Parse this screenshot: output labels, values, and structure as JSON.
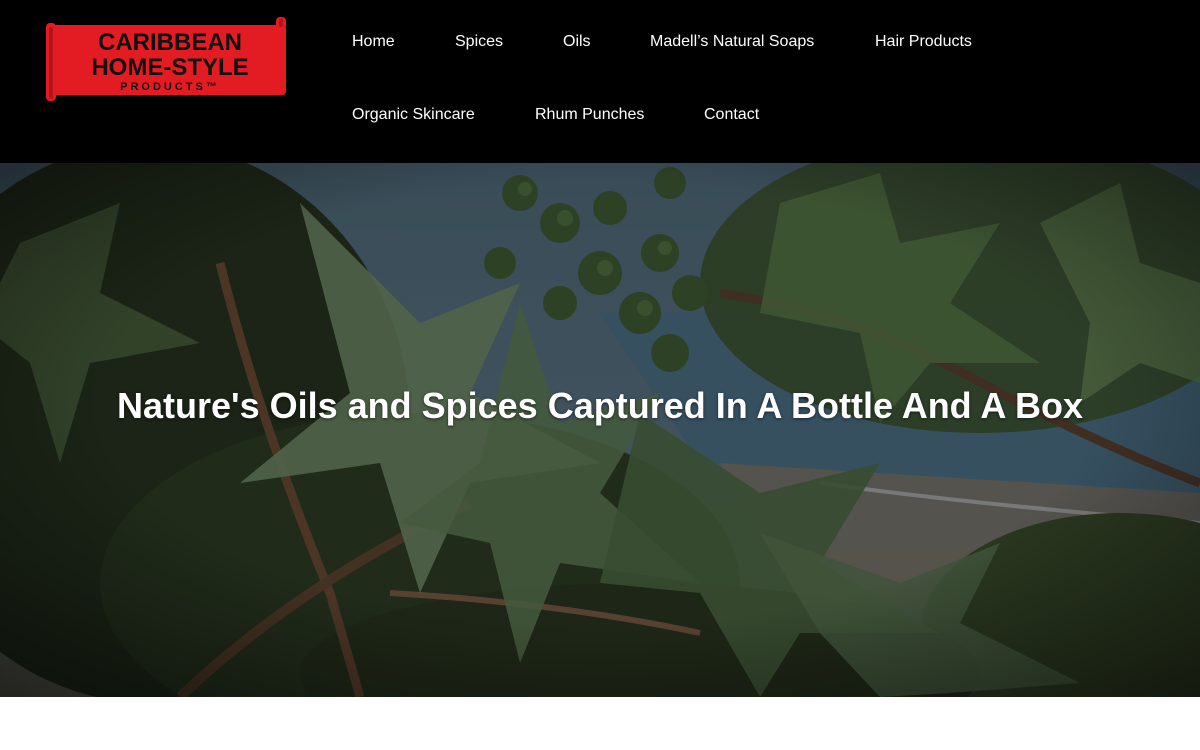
{
  "brand": {
    "logo_line1": "CARIBBEAN",
    "logo_line2": "HOME-STYLE",
    "logo_line3": "PRODUCTS™",
    "logo_color": "#e31b23"
  },
  "nav": {
    "items": [
      {
        "label": "Home"
      },
      {
        "label": "Spices"
      },
      {
        "label": "Oils"
      },
      {
        "label": "Madell’s Natural Soaps"
      },
      {
        "label": "Hair Products"
      },
      {
        "label": "Organic Skincare"
      },
      {
        "label": "Rhum Punches"
      },
      {
        "label": "Contact"
      }
    ]
  },
  "hero": {
    "title": "Nature's Oils and Spices Captured In A Bottle And A Box",
    "image": "castor-plant-leaves-photo"
  },
  "colors": {
    "header_bg": "#000000",
    "nav_text": "#ffffff",
    "hero_text": "#ffffff"
  }
}
